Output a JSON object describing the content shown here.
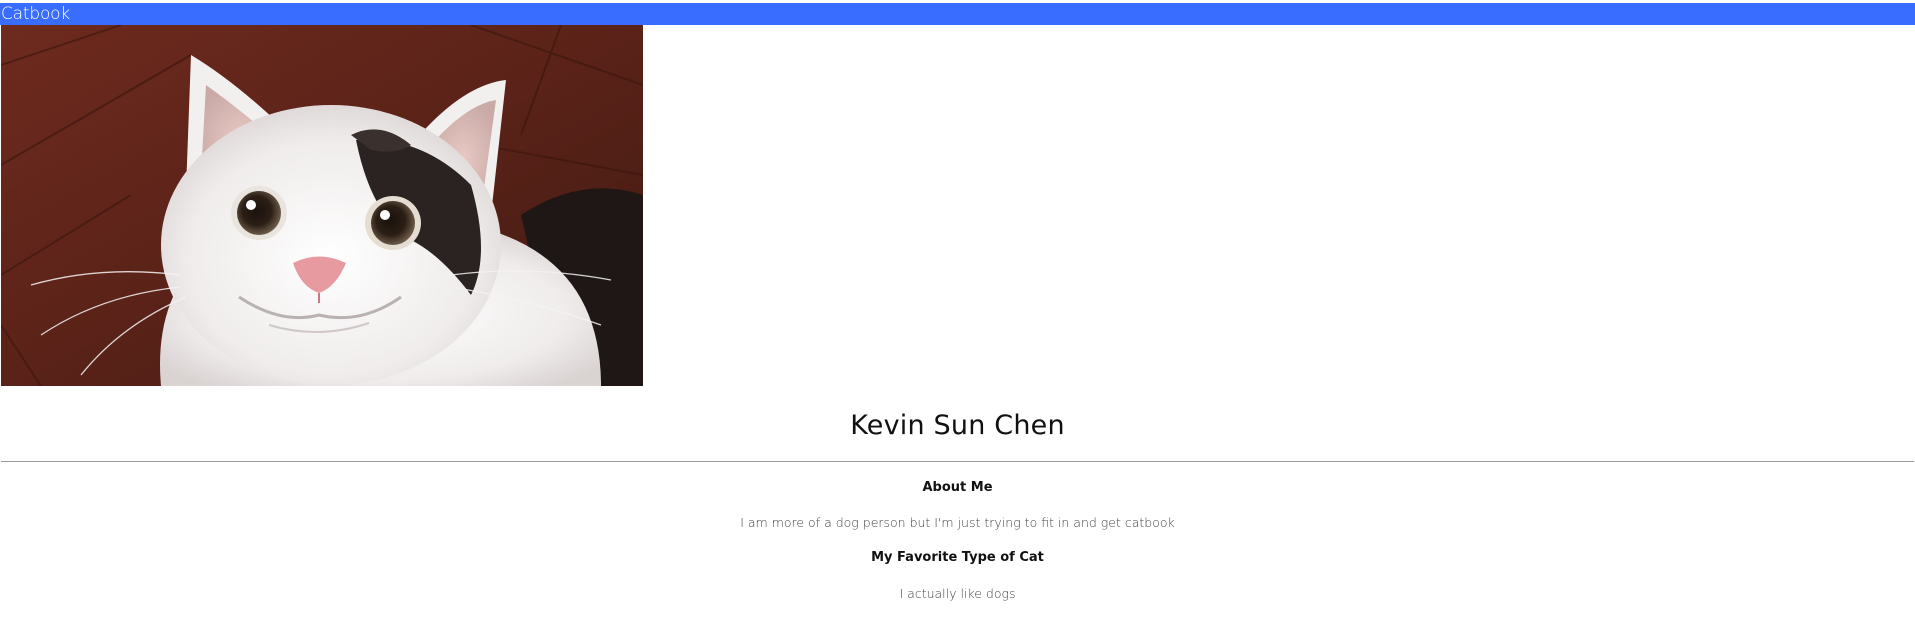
{
  "navbar": {
    "title": "Catbook",
    "background_color": "#396dff"
  },
  "profile": {
    "photo_icon": "cat-photo",
    "name": "Kevin Sun Chen"
  },
  "about_me": {
    "heading": "About Me",
    "text": "I am more of a dog person but I'm just trying to fit in and get catbook"
  },
  "favorite_cat": {
    "heading": "My Favorite Type of Cat",
    "text": "I actually like dogs"
  }
}
